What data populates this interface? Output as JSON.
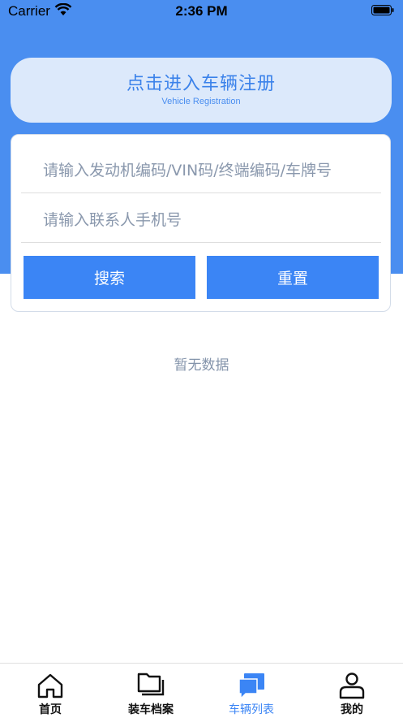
{
  "status_bar": {
    "carrier": "Carrier",
    "time": "2:36 PM"
  },
  "register": {
    "title": "点击进入车辆注册",
    "subtitle": "Vehicle Registration"
  },
  "search": {
    "vehicle_placeholder": "请输入发动机编码/VIN码/终端编码/车牌号",
    "phone_placeholder": "请输入联系人手机号",
    "search_label": "搜索",
    "reset_label": "重置"
  },
  "empty_text": "暂无数据",
  "tabs": [
    {
      "label": "首页",
      "icon": "home-icon",
      "active": false
    },
    {
      "label": "装车档案",
      "icon": "folder-icon",
      "active": false
    },
    {
      "label": "车辆列表",
      "icon": "chat-icon",
      "active": true
    },
    {
      "label": "我的",
      "icon": "person-icon",
      "active": false
    }
  ],
  "colors": {
    "primary": "#4a8ef0",
    "button": "#3b85f5",
    "banner": "#dce9fb"
  }
}
